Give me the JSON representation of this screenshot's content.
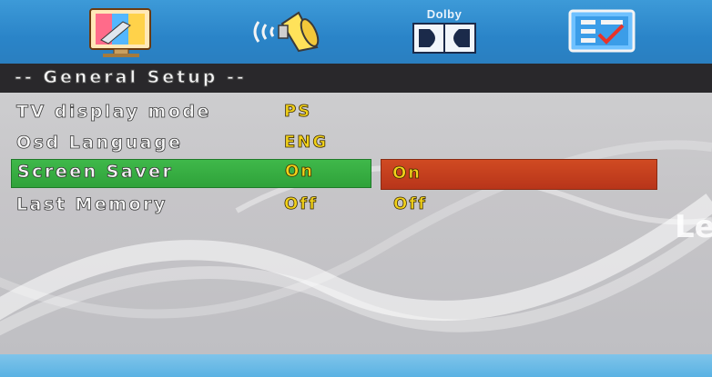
{
  "tabs": [
    {
      "icon": "general-setup-icon"
    },
    {
      "icon": "audio-speaker-icon"
    },
    {
      "icon": "dolby-icon",
      "label": "Dolby"
    },
    {
      "icon": "preference-checklist-icon"
    }
  ],
  "section": {
    "title": "-- General Setup --"
  },
  "rows": [
    {
      "label": "TV display mode",
      "value": "PS"
    },
    {
      "label": "Osd Language",
      "value": "ENG"
    },
    {
      "label": "Screen Saver",
      "value": "On"
    },
    {
      "label": "Last Memory",
      "value": "Off"
    }
  ],
  "options": {
    "selected": "On",
    "other": "Off"
  },
  "watermark": "Le",
  "colors": {
    "topbar": "#2a84c8",
    "header": "#29282b",
    "highlight_row": "#2fa23a",
    "option_highlight": "#c03c1e",
    "value_text": "#f2d21a",
    "bottombar": "#6ab9e6"
  }
}
